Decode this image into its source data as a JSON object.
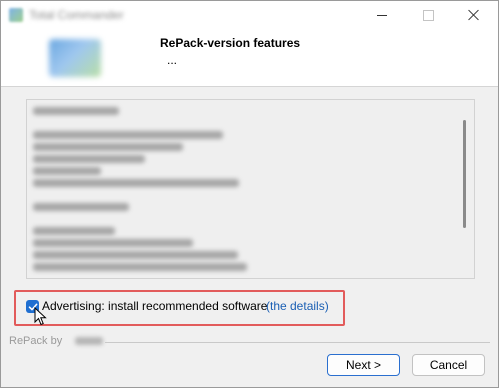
{
  "window": {
    "title": "Total Commander",
    "controls": {
      "minimize_icon": "minimize-icon",
      "maximize_icon": "maximize-icon",
      "close_icon": "close-icon"
    }
  },
  "header": {
    "title": "RePack-version features",
    "subtitle": "..."
  },
  "options": {
    "advertising_label": "Advertising: install recommended software",
    "details_link": "(the details)",
    "advertising_checked": true
  },
  "footer": {
    "repack_by": "RePack by",
    "next_label": "Next >",
    "cancel_label": "Cancel"
  },
  "colors": {
    "accent": "#1f6fd1",
    "highlight_border": "#e25b5b",
    "link": "#1a5fb4"
  }
}
